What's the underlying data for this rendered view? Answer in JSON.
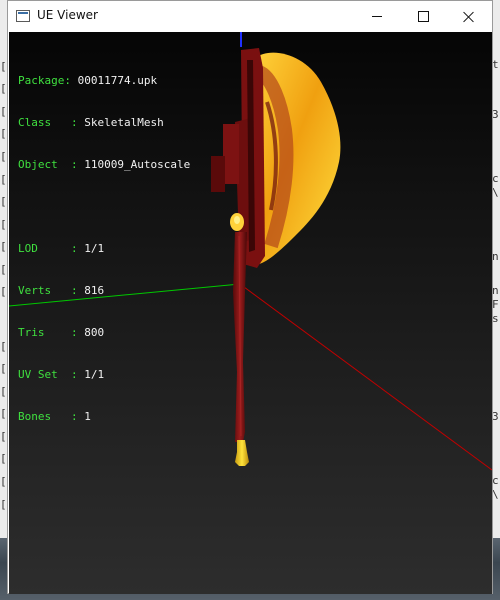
{
  "window": {
    "title": "UE Viewer"
  },
  "mesh_info": {
    "package": {
      "label": "Package: ",
      "value": "00011774.upk"
    },
    "class": {
      "label": "Class   : ",
      "value": "SkeletalMesh"
    },
    "object": {
      "label": "Object  : ",
      "value": "110009_Autoscale"
    },
    "lod": {
      "label": "LOD     : ",
      "value": "1/1"
    },
    "verts": {
      "label": "Verts   : ",
      "value": "816"
    },
    "tris": {
      "label": "Tris    : ",
      "value": "800"
    },
    "uvset": {
      "label": "UV Set  : ",
      "value": "1/1"
    },
    "bones": {
      "label": "Bones   : ",
      "value": "1"
    }
  },
  "colors": {
    "label": "#3fe03f",
    "value": "#f1f1f1",
    "axis_x": "#00c800",
    "axis_y": "#c00000",
    "axis_z": "#2030ff"
  }
}
